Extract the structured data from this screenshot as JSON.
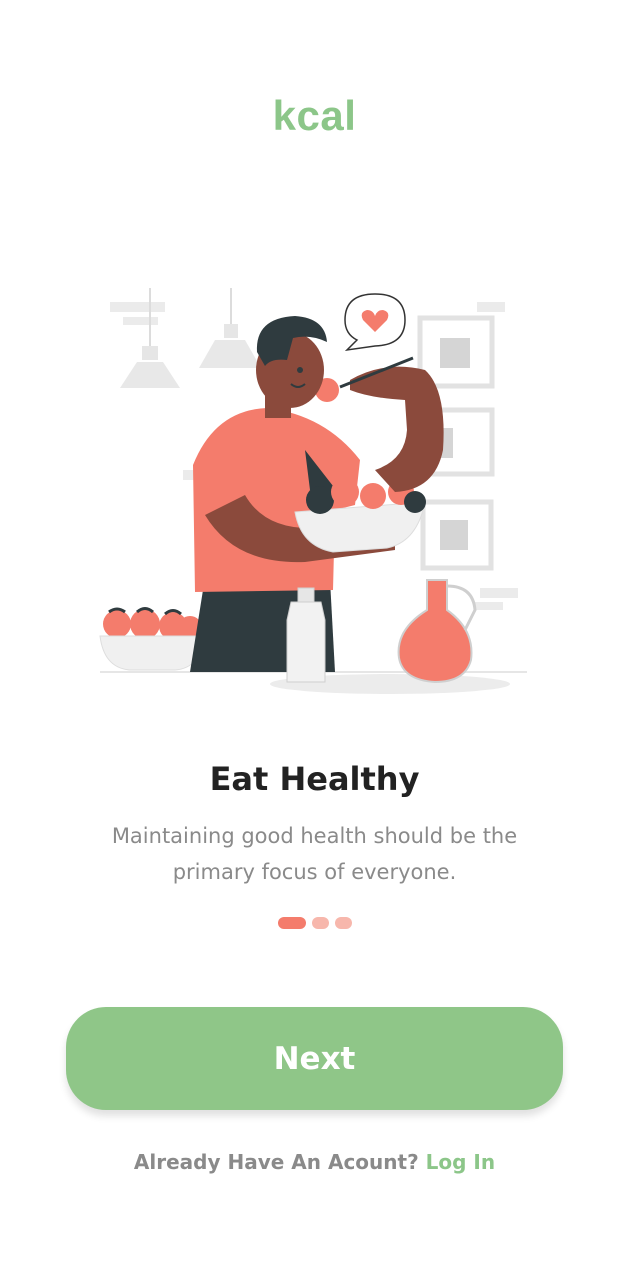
{
  "app": {
    "logo_text": "kcal",
    "brand_color": "#8cc689",
    "accent_color": "#f47c6c"
  },
  "onboarding": {
    "illustration": "person-eating-healthy-illustration",
    "title": "Eat Healthy",
    "subtitle": "Maintaining good health should be the primary focus of everyone.",
    "current_page": 1,
    "total_pages": 3
  },
  "actions": {
    "next_label": "Next",
    "account_prompt": "Already Have An Acount?",
    "login_label": "Log In"
  }
}
